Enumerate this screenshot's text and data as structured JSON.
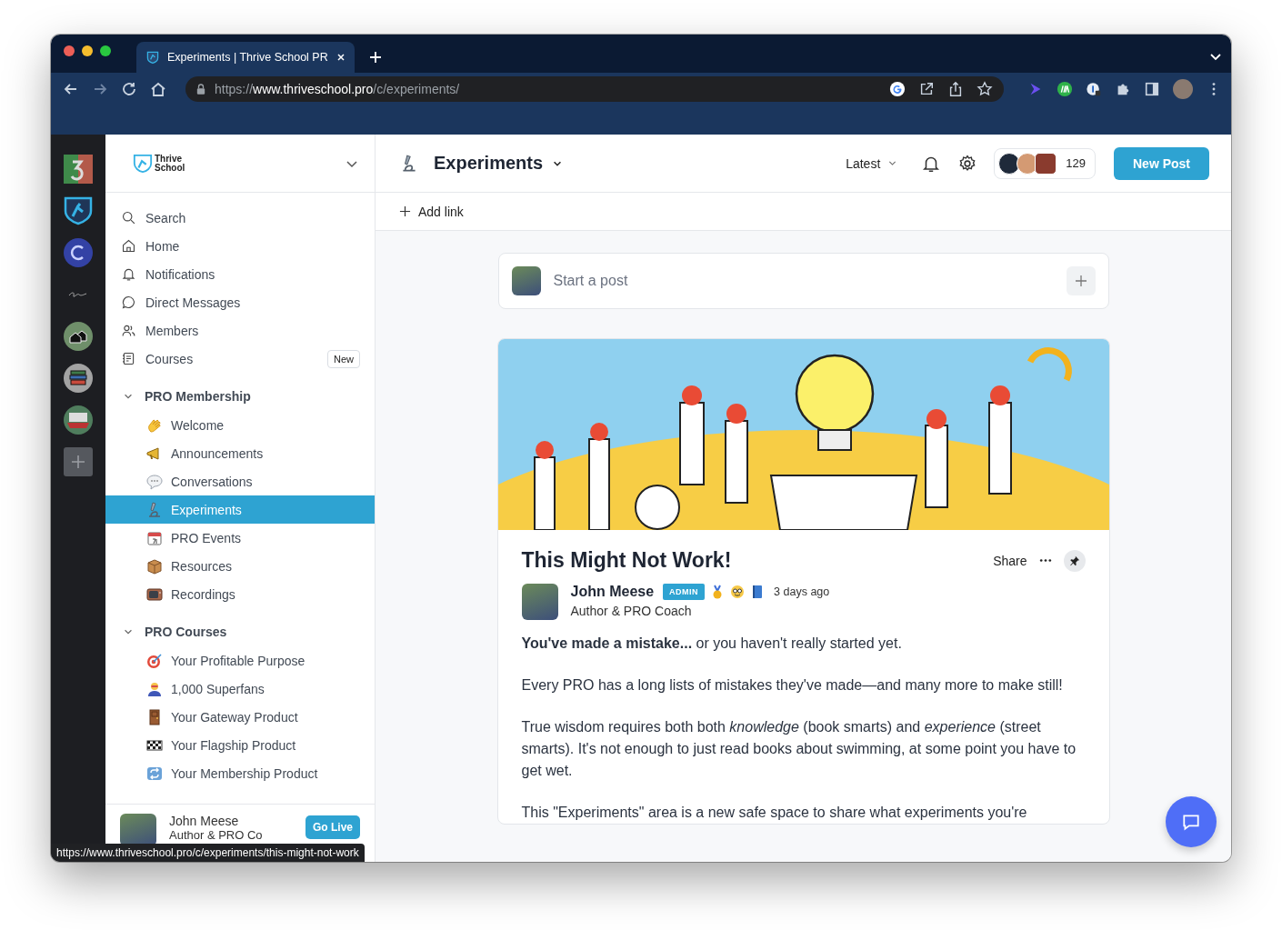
{
  "browser": {
    "tab_title": "Experiments | Thrive School PR",
    "url_scheme": "https://",
    "url_host": "www.thriveschool.pro",
    "url_path": "/c/experiments/",
    "status_url": "https://www.thriveschool.pro/c/experiments/this-might-not-work"
  },
  "brand": {
    "line_1": "Thrive",
    "line_2": "School"
  },
  "nav": [
    {
      "label": "Search"
    },
    {
      "label": "Home"
    },
    {
      "label": "Notifications"
    },
    {
      "label": "Direct Messages"
    },
    {
      "label": "Members"
    },
    {
      "label": "Courses",
      "badge": "New"
    }
  ],
  "groups": [
    {
      "title": "PRO Membership",
      "expanded": true,
      "items": [
        {
          "label": "Welcome",
          "selected": false
        },
        {
          "label": "Announcements",
          "selected": false
        },
        {
          "label": "Conversations",
          "selected": false
        },
        {
          "label": "Experiments",
          "selected": true
        },
        {
          "label": "PRO Events",
          "selected": false
        },
        {
          "label": "Resources",
          "selected": false
        },
        {
          "label": "Recordings",
          "selected": false
        }
      ]
    },
    {
      "title": "PRO Courses",
      "expanded": true,
      "items": [
        {
          "label": "Your Profitable Purpose",
          "selected": false
        },
        {
          "label": "1,000 Superfans",
          "selected": false
        },
        {
          "label": "Your Gateway Product",
          "selected": false
        },
        {
          "label": "Your Flagship Product",
          "selected": false
        },
        {
          "label": "Your Membership Product",
          "selected": false
        }
      ]
    }
  ],
  "footer_user": {
    "name": "John Meese",
    "role": "Author & PRO Co",
    "action": "Go Live"
  },
  "header": {
    "title": "Experiments",
    "sort": "Latest",
    "member_count": "129",
    "new_post": "New Post",
    "add_link": "Add link"
  },
  "composer": {
    "placeholder": "Start a post"
  },
  "post": {
    "title": "This Might Not Work!",
    "share": "Share",
    "author": "John Meese",
    "badge": "ADMIN",
    "time": "3 days ago",
    "role": "Author & PRO Coach",
    "paragraphs": [
      "**You've made a mistake...** or you haven't really started yet.",
      "Every PRO has a long lists of mistakes they've made—and many more to make still!",
      "True wisdom requires both both *knowledge* (book smarts) and *experience* (street smarts). It's not enough to just read books about swimming, at some point you have to get wet.",
      "This \"Experiments\" area is a new safe space to share what experiments you're"
    ]
  }
}
